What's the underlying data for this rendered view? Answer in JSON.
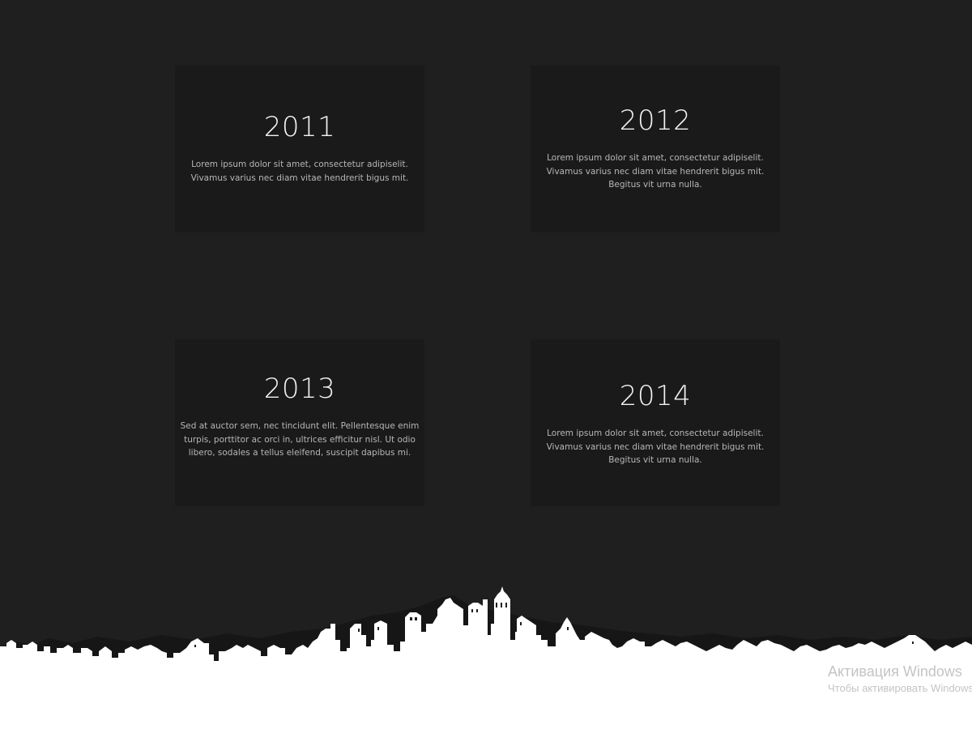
{
  "timeline": {
    "cards": [
      {
        "year": "2011",
        "text": "Lorem ipsum dolor sit amet, consectetur adipiselit. Vivamus varius nec diam vitae hendrerit bigus mit."
      },
      {
        "year": "2012",
        "text": "Lorem ipsum dolor sit amet, consectetur adipiselit. Vivamus varius nec diam vitae hendrerit bigus mit. Begitus vit urna nulla."
      },
      {
        "year": "2013",
        "text": "Sed at auctor sem, nec tincidunt elit. Pellentesque enim turpis, porttitor ac orci in, ultrices efficitur nisl. Ut odio libero, sodales a tellus eleifend, suscipit dapibus mi."
      },
      {
        "year": "2014",
        "text": "Lorem ipsum dolor sit amet, consectetur adipiselit. Vivamus varius nec diam vitae hendrerit bigus mit. Begitus vit urna nulla."
      }
    ]
  },
  "watermark": {
    "title": "Активация Windows",
    "subtitle": "Чтобы активировать Windows"
  },
  "colors": {
    "background": "#1f1f1f",
    "card_background": "#1a1a1a",
    "skyline_fill": "#ffffff"
  },
  "icons": {
    "skyline": "city-skyline-silhouette"
  }
}
